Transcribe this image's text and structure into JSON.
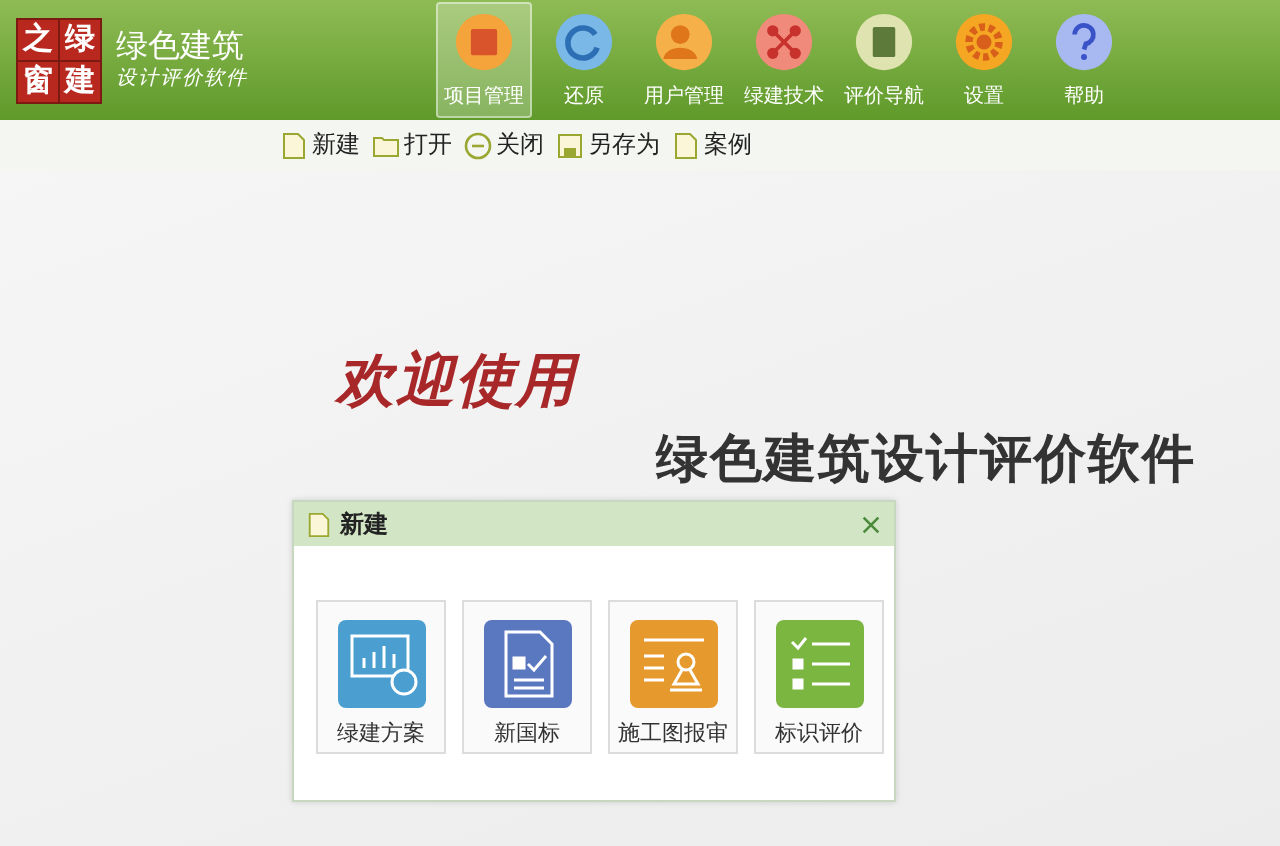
{
  "logo": {
    "chars": [
      "之",
      "绿",
      "窗",
      "建"
    ],
    "title": "绿色建筑",
    "subtitle": "设计评价软件"
  },
  "nav": [
    {
      "label": "项目管理",
      "kind": "project",
      "selected": true
    },
    {
      "label": "还原",
      "kind": "restore",
      "selected": false
    },
    {
      "label": "用户管理",
      "kind": "user",
      "selected": false
    },
    {
      "label": "绿建技术",
      "kind": "tech",
      "selected": false
    },
    {
      "label": "评价导航",
      "kind": "guide",
      "selected": false
    },
    {
      "label": "设置",
      "kind": "settings",
      "selected": false
    },
    {
      "label": "帮助",
      "kind": "help",
      "selected": false
    }
  ],
  "toolbar": [
    {
      "label": "新建",
      "kind": "new"
    },
    {
      "label": "打开",
      "kind": "open"
    },
    {
      "label": "关闭",
      "kind": "close"
    },
    {
      "label": "另存为",
      "kind": "save"
    },
    {
      "label": "案例",
      "kind": "doc"
    }
  ],
  "welcome": {
    "greeting": "欢迎使用",
    "product": "绿色建筑设计评价软件"
  },
  "dialog": {
    "title": "新建",
    "options": [
      {
        "label": "绿建方案",
        "kind": "plan"
      },
      {
        "label": "新国标",
        "kind": "standard"
      },
      {
        "label": "施工图报审",
        "kind": "review"
      },
      {
        "label": "标识评价",
        "kind": "rating"
      }
    ]
  }
}
